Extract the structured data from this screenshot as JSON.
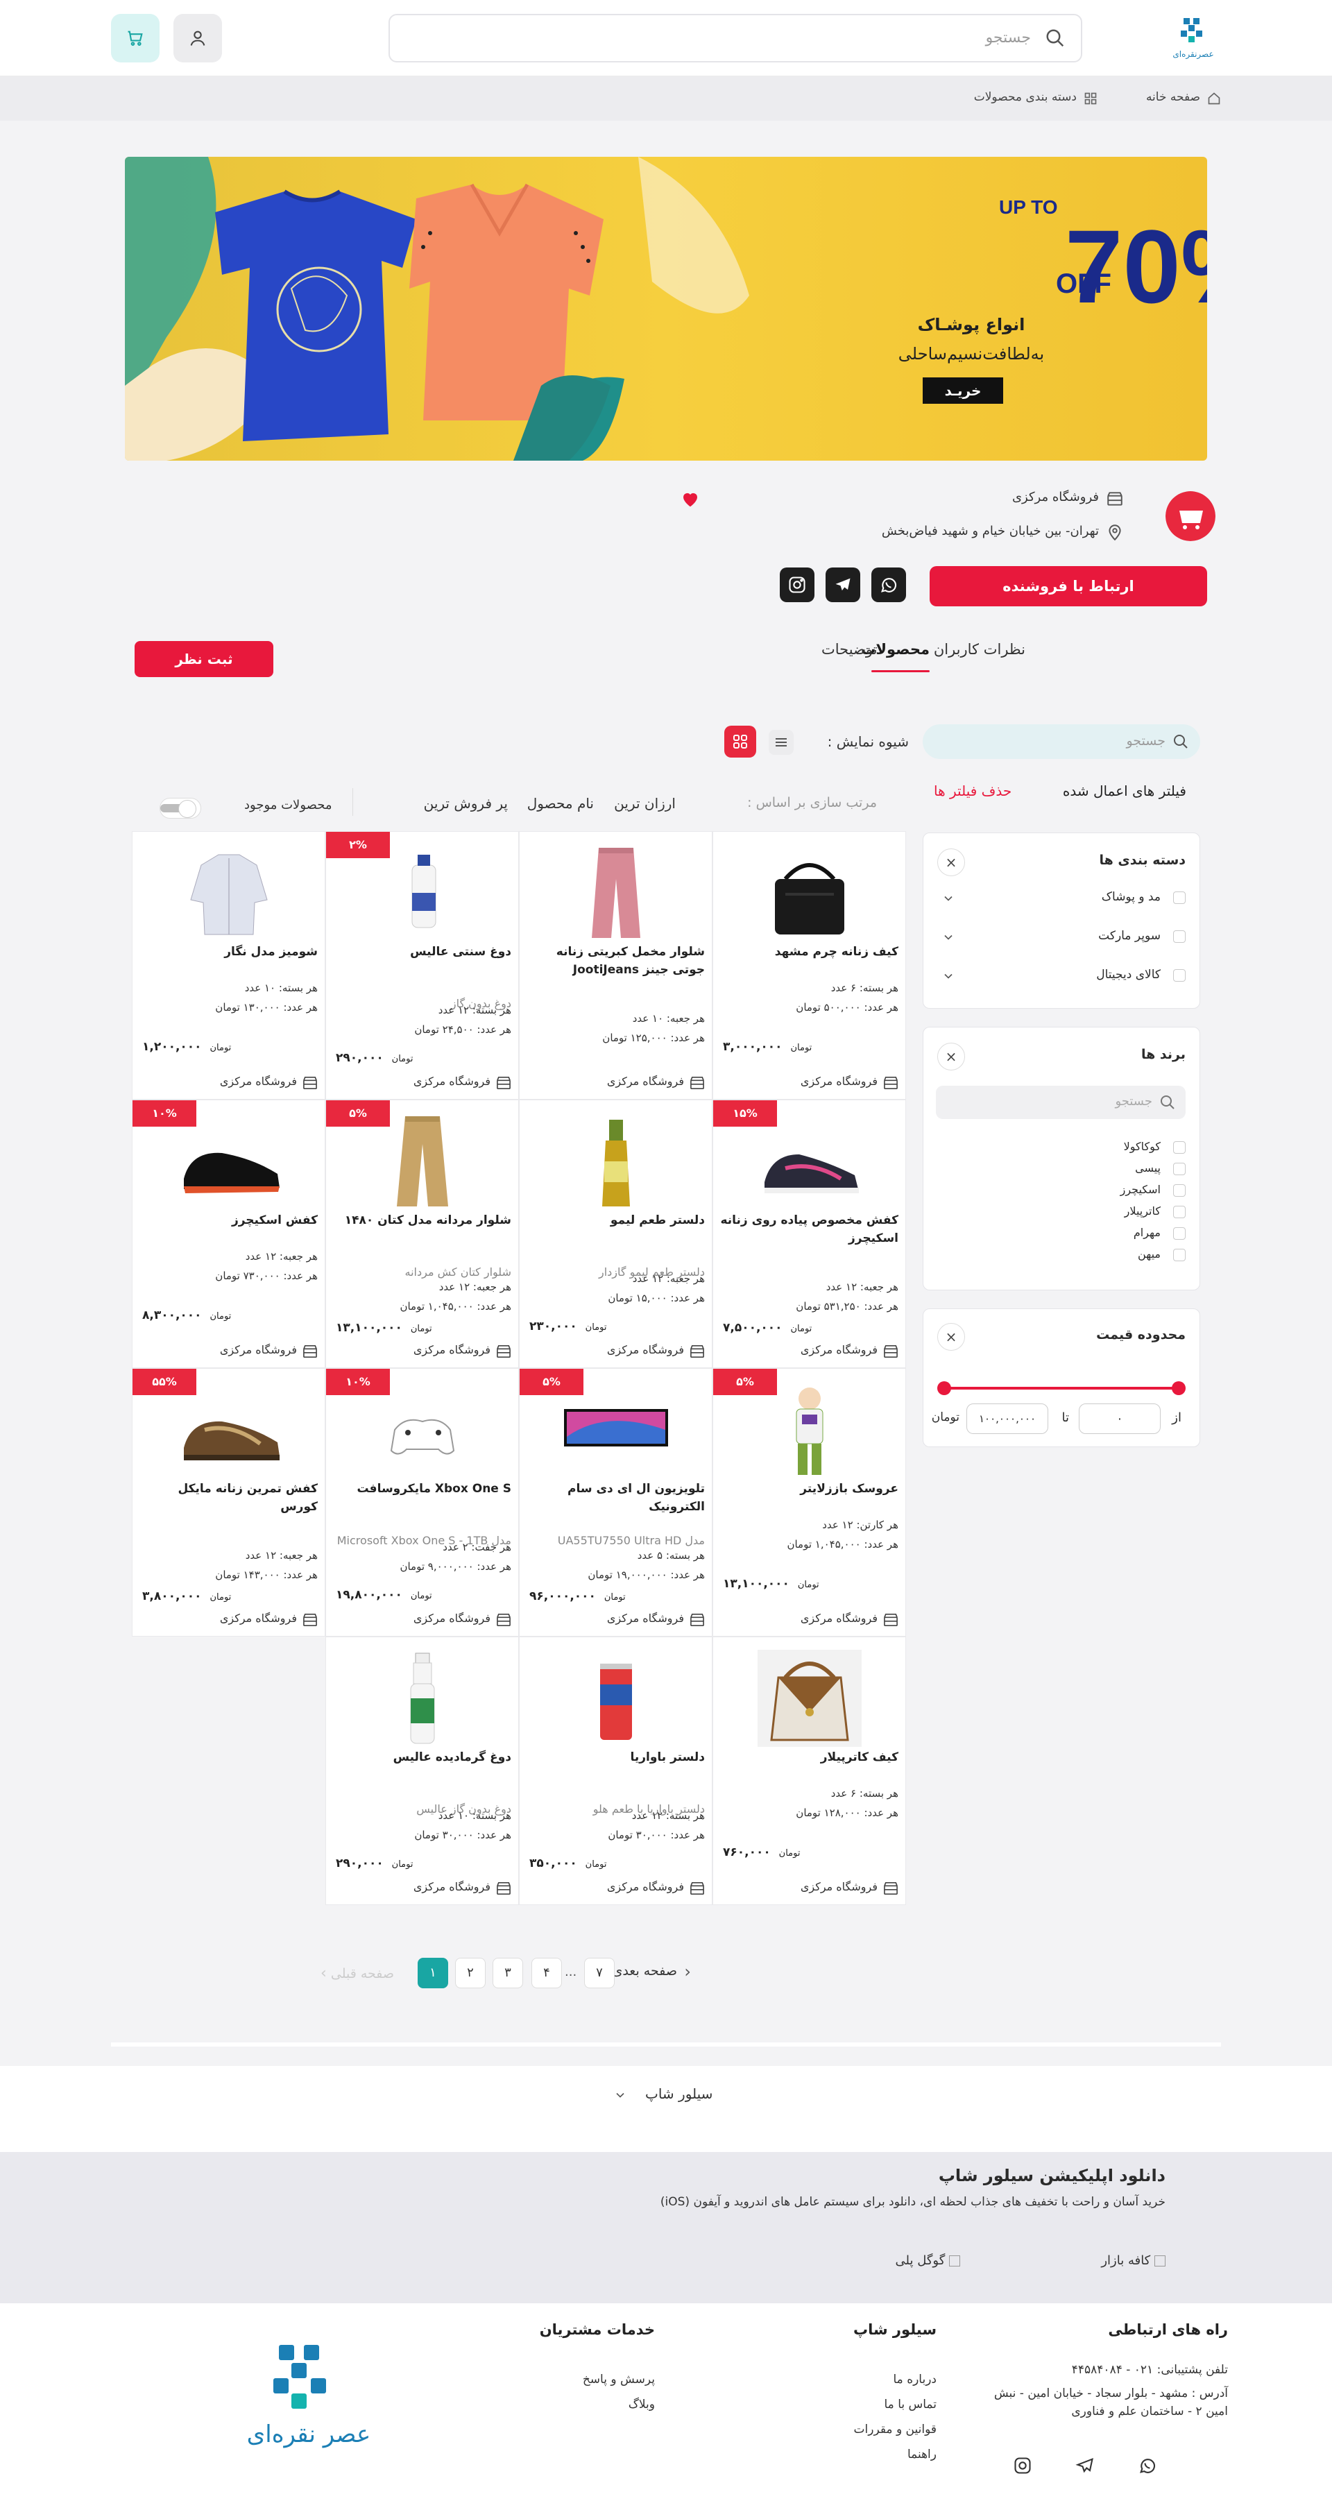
{
  "header": {
    "search_placeholder": "جستجو"
  },
  "breadcrumb": {
    "home": "صفحه خانه",
    "categories": "دسته بندی محصولات"
  },
  "banner": {
    "up_to": "UP TO",
    "percent": "70%",
    "off": "OFF",
    "line1": "انواع پوشـاک",
    "line2": "به‌لطافت‌نسیم‌ساحلی",
    "cta": "خریـد"
  },
  "store": {
    "name": "فروشگاه مرکزی",
    "address": "تهران- بین خیابان خیام و شهید فیاض‌بخش",
    "contact_button": "ارتباط با فروشنده"
  },
  "tabs": {
    "products": "محصولات",
    "reviews": "نظرات کاربران",
    "description": "توضیحات",
    "review_button": "ثبت نظر"
  },
  "sidebar": {
    "search_placeholder": "جستجو",
    "applied_filters": "فیلتر های اعمال شده",
    "clear_filters": "حذف فیلتر ها",
    "categories_title": "دسته بندی ها",
    "categories": [
      "مد و پوشاک",
      "سوپر مارکت",
      "کالای دیجیتال"
    ],
    "brands_title": "برند ها",
    "brand_search_placeholder": "جستجو",
    "brands": [
      "کوکاکولا",
      "پیسی",
      "اسکیچرز",
      "کاترپیلار",
      "مهرام",
      "میهن"
    ],
    "price_title": "محدوده قیمت",
    "price_from_label": "از",
    "price_from": "۰",
    "price_to_label": "تا",
    "price_to": "۱۰۰,۰۰۰,۰۰۰",
    "price_unit": "تومان"
  },
  "toolbar": {
    "display_label": "شیوه نمایش :",
    "sort_label": "مرتب سازی بر اساس :",
    "sort_options": [
      "ارزان ترین",
      "نام محصول",
      "پر فروش ترین"
    ],
    "in_stock": "محصولات موجود"
  },
  "products": [
    {
      "name": "کیف زنانه چرم مشهد",
      "sub": "",
      "l1": "هر بسته: ۶ عدد",
      "l2": "هر عدد: ۵۰۰,۰۰۰ تومان",
      "price": "۳,۰۰۰,۰۰۰",
      "discount": "",
      "img": "bag"
    },
    {
      "name": "شلوار مخمل کبریتی زنانه جوتی جینز JootiJeans",
      "sub": "",
      "l1": "هر جعبه: ۱۰ عدد",
      "l2": "هر عدد: ۱۲۵,۰۰۰ تومان",
      "price": "",
      "discount": "",
      "img": "pants"
    },
    {
      "name": "دوغ سنتی عالیس",
      "sub": "دوغ بدون گاز",
      "l1": "هر بسته: ۱۲ عدد",
      "l2": "هر عدد: ۲۴,۵۰۰ تومان",
      "price": "۲۹۰,۰۰۰",
      "discount": "۲%",
      "img": "doogh"
    },
    {
      "name": "شومیز مدل نگار",
      "sub": "",
      "l1": "هر بسته: ۱۰ عدد",
      "l2": "هر عدد: ۱۳۰,۰۰۰ تومان",
      "price": "۱,۲۰۰,۰۰۰",
      "discount": "",
      "img": "shirt"
    },
    {
      "name": "کفش مخصوص پیاده روی زنانه اسکیچرز",
      "sub": "",
      "l1": "هر جعبه: ۱۲ عدد",
      "l2": "هر عدد: ۵۳۱,۲۵۰ تومان",
      "price": "۷,۵۰۰,۰۰۰",
      "discount": "۱۵%",
      "img": "shoe-pink"
    },
    {
      "name": "دلستر طعم لیمو",
      "sub": "دلستر طعم لیمو گازدار",
      "l1": "هر جعبه: ۱۲ عدد",
      "l2": "هر عدد: ۱۵,۰۰۰ تومان",
      "price": "۲۳۰,۰۰۰",
      "discount": "",
      "img": "bottle-lemon"
    },
    {
      "name": "شلوار مردانه مدل کتان ۱۴۸۰",
      "sub": "شلوار کتان کش مردانه",
      "l1": "هر جعبه: ۱۲ عدد",
      "l2": "هر عدد: ۱,۰۴۵,۰۰۰ تومان",
      "price": "۱۳,۱۰۰,۰۰۰",
      "discount": "۵%",
      "img": "chino"
    },
    {
      "name": "کفش اسکیچرز",
      "sub": "",
      "l1": "هر جعبه: ۱۲ عدد",
      "l2": "هر عدد: ۷۳۰,۰۰۰ تومان",
      "price": "۸,۳۰۰,۰۰۰",
      "discount": "۱۰%",
      "img": "shoe-black"
    },
    {
      "name": "عروسک باززلایتر",
      "sub": "",
      "l1": "هر کارتن: ۱۲ عدد",
      "l2": "هر عدد: ۱,۰۴۵,۰۰۰ تومان",
      "price": "۱۳,۱۰۰,۰۰۰",
      "discount": "۵%",
      "img": "toy"
    },
    {
      "name": "تلویزیون ال ای دی سام الکترونیک",
      "sub": "مدل UA55TU7550 Ultra HD",
      "l1": "هر بسته: ۵ عدد",
      "l2": "هر عدد: ۱۹,۰۰۰,۰۰۰ تومان",
      "price": "۹۶,۰۰۰,۰۰۰",
      "discount": "۵%",
      "img": "tv"
    },
    {
      "name": "Xbox One S مایکروسافت",
      "sub": "مدل Microsoft Xbox One S - 1TB",
      "l1": "هر جفت: ۲ عدد",
      "l2": "هر عدد: ۹,۰۰۰,۰۰۰ تومان",
      "price": "۱۹,۸۰۰,۰۰۰",
      "discount": "۱۰%",
      "img": "xbox"
    },
    {
      "name": "کفش تمرین زنانه مایکل کورس",
      "sub": "",
      "l1": "هر جعبه: ۱۲ عدد",
      "l2": "هر عدد: ۱۴۳,۰۰۰ تومان",
      "price": "۳,۸۰۰,۰۰۰",
      "discount": "۵۵%",
      "img": "shoe-brown"
    },
    {
      "name": "کیف کاترپیلار",
      "sub": "",
      "l1": "هر بسته: ۶ عدد",
      "l2": "هر عدد: ۱۲۸,۰۰۰ تومان",
      "price": "۷۶۰,۰۰۰",
      "discount": "",
      "img": "bag-mk"
    },
    {
      "name": "دلستر باواریا",
      "sub": "دلستر باواریا با طعم هلو",
      "l1": "هر بسته: ۱۲ عدد",
      "l2": "هر عدد: ۳۰,۰۰۰ تومان",
      "price": "۳۵۰,۰۰۰",
      "discount": "",
      "img": "can"
    },
    {
      "name": "دوغ گرمادیده عالیس",
      "sub": "دوغ بدون گاز عالیس",
      "l1": "هر بسته: ۱۰ عدد",
      "l2": "هر عدد: ۳۰,۰۰۰ تومان",
      "price": "۲۹۰,۰۰۰",
      "discount": "",
      "img": "bottle-green"
    }
  ],
  "card": {
    "store_label": "فروشگاه مرکزی",
    "currency": "تومان"
  },
  "pagination": {
    "next": "صفحه بعدی",
    "prev": "صفحه قبلی",
    "pages": [
      "۷",
      "...",
      "۴",
      "۳",
      "۲",
      "۱"
    ]
  },
  "footer": {
    "brand_collapse": "سیلور شاپ",
    "app_title": "دانلود اپلیکیشن سیلور شاپ",
    "app_desc": "خرید آسان و راحت با تخفیف های جذاب لحظه ای، دانلود برای سیستم عامل های اندروید و آیفون (iOS)",
    "bazaar": "کافه بازار",
    "googleplay": "گوگل پلی",
    "contact_title": "راه های ارتباطی",
    "phone": "تلفن پشتیبانی: ۰۲۱ - ۴۴۵۸۴۰۸۴",
    "address1": "آدرس : مشهد - بلوار سجاد - خیابان امین - نبش",
    "address2": "امین ۲ - ساختمان علم و فناوری",
    "shop_title": "سیلور شاپ",
    "shop_links": [
      "درباره ما",
      "تماس با ما",
      "قوانین و مقررات",
      "راهنما"
    ],
    "services_title": "خدمات مشتریان",
    "services_links": [
      "پرسش و پاسخ",
      "وبلاگ"
    ],
    "logo_text": "عصر نقره‌ای"
  }
}
